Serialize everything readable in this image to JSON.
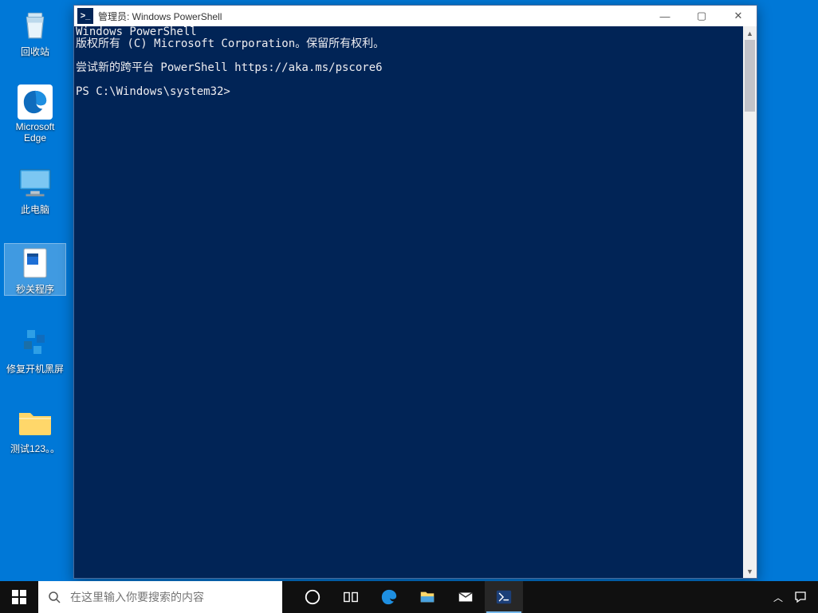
{
  "desktop": {
    "icons": [
      {
        "name": "recycle-bin",
        "label": "回收站"
      },
      {
        "name": "edge",
        "label": "Microsoft Edge"
      },
      {
        "name": "this-pc",
        "label": "此电脑"
      },
      {
        "name": "sec-program",
        "label": "秒关程序"
      },
      {
        "name": "fix-boot",
        "label": "修复开机黑屏"
      },
      {
        "name": "test-folder",
        "label": "测试123。。"
      }
    ],
    "selected_index": 3
  },
  "powershell": {
    "title": "管理员: Windows PowerShell",
    "lines": [
      "Windows PowerShell",
      "版权所有 (C) Microsoft Corporation。保留所有权利。",
      "",
      "尝试新的跨平台 PowerShell https://aka.ms/pscore6",
      "",
      "PS C:\\Windows\\system32>"
    ],
    "window_controls": {
      "min": "—",
      "max": "▢",
      "close": "✕"
    }
  },
  "taskbar": {
    "search_placeholder": "在这里输入你要搜索的内容",
    "items": [
      {
        "name": "cortana",
        "active": false
      },
      {
        "name": "task-view",
        "active": false
      },
      {
        "name": "edge",
        "active": false
      },
      {
        "name": "file-explorer",
        "active": false
      },
      {
        "name": "mail",
        "active": false
      },
      {
        "name": "powershell",
        "active": true
      }
    ],
    "tray": [
      "chevron-up",
      "action-center"
    ]
  }
}
